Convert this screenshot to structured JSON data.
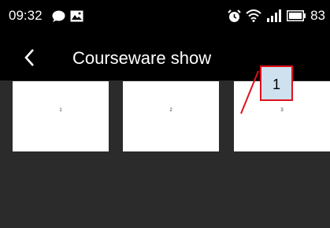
{
  "status_bar": {
    "time": "09:32",
    "battery_level": "83",
    "left_icons": [
      "chat-bubble-icon",
      "image-icon"
    ],
    "right_icons": [
      "alarm-icon",
      "wifi-icon",
      "signal-icon",
      "battery-icon"
    ]
  },
  "header": {
    "title": "Courseware show",
    "back_icon": "chevron-left-icon"
  },
  "slides": [
    {
      "label": "1"
    },
    {
      "label": "2"
    },
    {
      "label": "3"
    }
  ],
  "annotation": {
    "label": "1",
    "border_color": "#e0101a",
    "fill_color": "#cfe0ee"
  },
  "colors": {
    "bar_background": "#000000",
    "content_background": "#2b2b2b",
    "slide_background": "#ffffff"
  }
}
